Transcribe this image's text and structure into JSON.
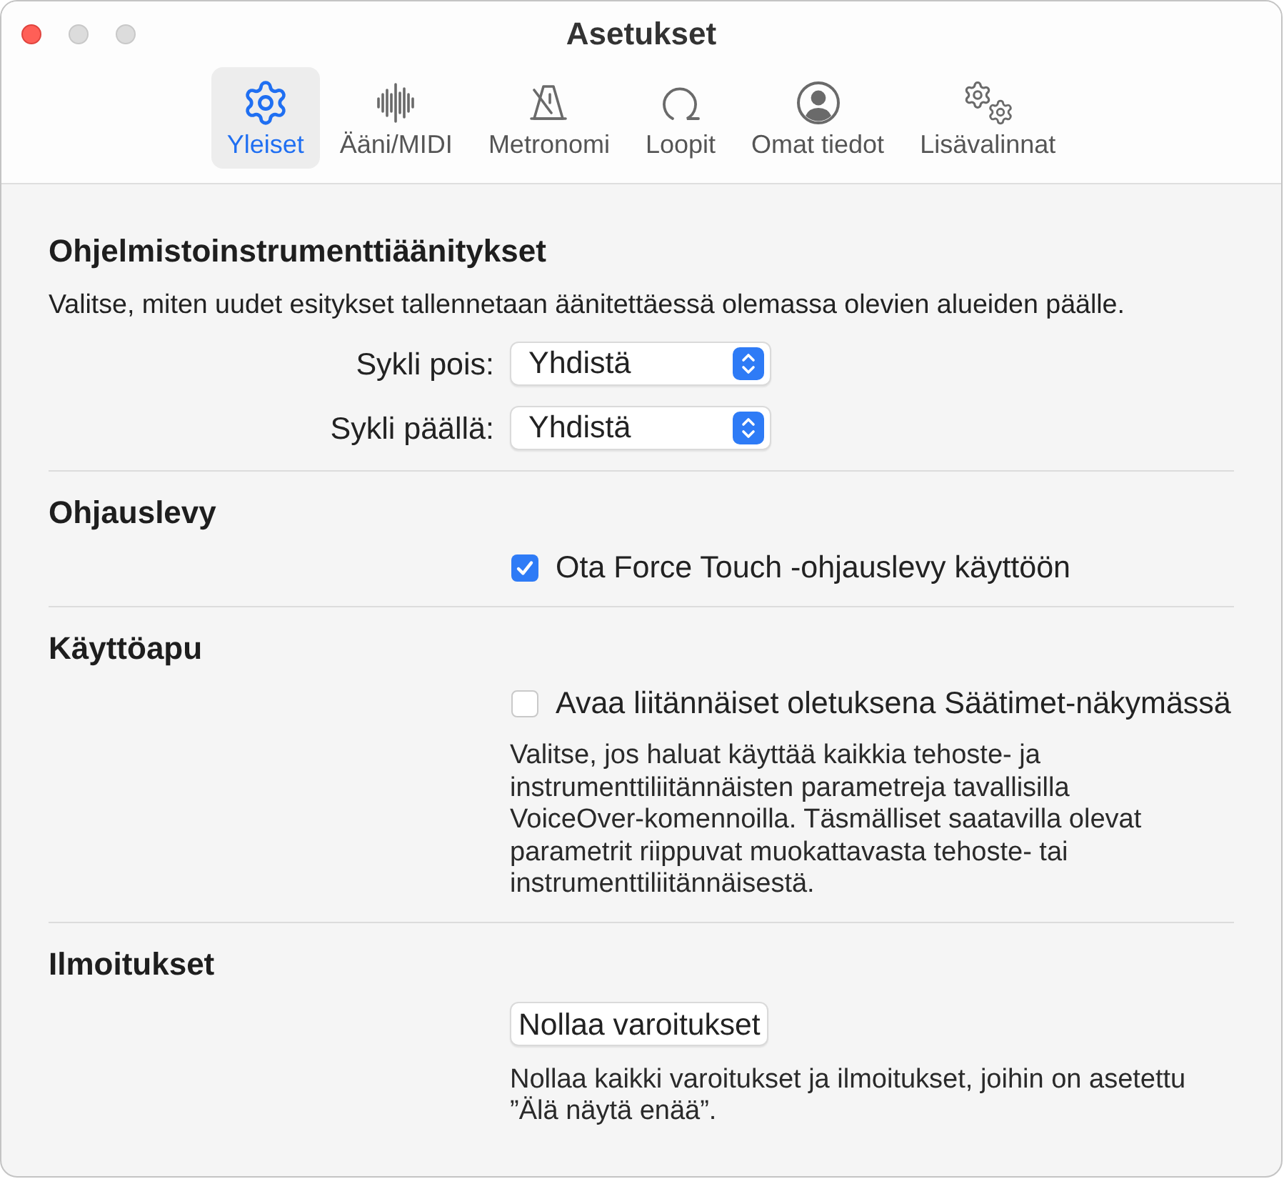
{
  "window": {
    "title": "Asetukset",
    "controls": [
      {
        "kind": "close",
        "disabled": false
      },
      {
        "kind": "minimize",
        "disabled": true
      },
      {
        "kind": "zoom",
        "disabled": true
      }
    ]
  },
  "tabs": [
    {
      "kind": "gear",
      "label": "Yleiset",
      "selected": true
    },
    {
      "kind": "waveform",
      "label": "Ääni/MIDI",
      "selected": false
    },
    {
      "kind": "metronome",
      "label": "Metronomi",
      "selected": false
    },
    {
      "kind": "loop",
      "label": "Loopit",
      "selected": false
    },
    {
      "kind": "person",
      "label": "Omat tiedot",
      "selected": false
    },
    {
      "kind": "gears",
      "label": "Lisävalinnat",
      "selected": false
    }
  ],
  "sections": [
    {
      "heading": "Ohjelmistoinstrumenttiäänitykset",
      "items": [
        {
          "kind": "description",
          "text": "Valitse, miten uudet esitykset tallennetaan äänitettäessä olemassa olevien alueiden päälle."
        },
        {
          "kind": "popup",
          "label": "Sykli pois:",
          "value": "Yhdistä"
        },
        {
          "kind": "popup",
          "label": "Sykli päällä:",
          "value": "Yhdistä"
        }
      ]
    },
    {
      "heading": "Ohjauslevy",
      "items": [
        {
          "kind": "checkbox",
          "label": "Ota Force Touch -ohjauslevy käyttöön",
          "checked": true
        }
      ]
    },
    {
      "heading": "Käyttöapu",
      "items": [
        {
          "kind": "checkbox",
          "label": "Avaa liitännäiset oletuksena Säätimet-näkymässä",
          "checked": false
        },
        {
          "kind": "note",
          "text": "Valitse, jos haluat käyttää kaikkia tehoste- ja instrumenttiliitännäisten parametreja tavallisilla VoiceOver-komennoilla. Täsmälliset saatavilla olevat parametrit riippuvat muokattavasta tehoste- tai instrumenttiliitännäisestä."
        }
      ]
    },
    {
      "heading": "Ilmoitukset",
      "items": [
        {
          "kind": "button",
          "label": "Nollaa varoitukset"
        },
        {
          "kind": "note",
          "text": "Nollaa kaikki varoitukset ja ilmoitukset, joihin on asetettu ”Älä näytä enää”."
        }
      ]
    }
  ]
}
